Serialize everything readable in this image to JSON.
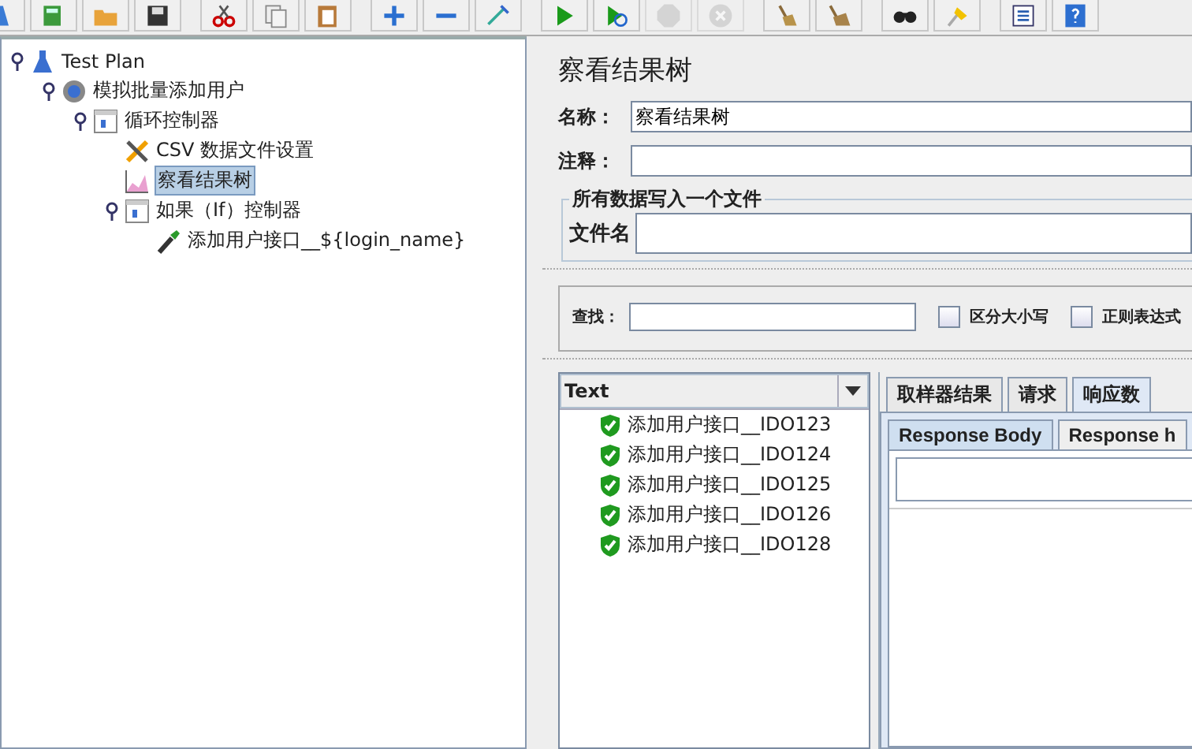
{
  "toolbar": {
    "groups": [
      [
        {
          "kind": "new",
          "disabled": false
        },
        {
          "kind": "templates",
          "disabled": false
        },
        {
          "kind": "open",
          "disabled": false
        },
        {
          "kind": "save",
          "disabled": false
        }
      ],
      [
        {
          "kind": "cut",
          "disabled": false
        },
        {
          "kind": "copy",
          "disabled": false
        },
        {
          "kind": "paste",
          "disabled": false
        }
      ],
      [
        {
          "kind": "expand",
          "disabled": false
        },
        {
          "kind": "collapse",
          "disabled": false
        },
        {
          "kind": "toggle",
          "disabled": false
        }
      ],
      [
        {
          "kind": "start",
          "disabled": false
        },
        {
          "kind": "start-no-pause",
          "disabled": false
        },
        {
          "kind": "stop",
          "disabled": true
        },
        {
          "kind": "shutdown",
          "disabled": true
        }
      ],
      [
        {
          "kind": "clear",
          "disabled": false
        },
        {
          "kind": "clear-all",
          "disabled": false
        }
      ],
      [
        {
          "kind": "search",
          "disabled": false
        },
        {
          "kind": "reset-search",
          "disabled": false
        }
      ],
      [
        {
          "kind": "functions",
          "disabled": false
        },
        {
          "kind": "help",
          "disabled": false
        }
      ]
    ]
  },
  "tree": [
    {
      "label": "Test Plan",
      "kind": "plan",
      "selected": false,
      "children": [
        {
          "label": "模拟批量添加用户",
          "kind": "thread",
          "selected": false,
          "children": [
            {
              "label": "循环控制器",
              "kind": "controller",
              "selected": false,
              "children": [
                {
                  "label": "CSV 数据文件设置",
                  "kind": "config",
                  "selected": false
                },
                {
                  "label": "察看结果树",
                  "kind": "listener",
                  "selected": true
                },
                {
                  "label": "如果（If）控制器",
                  "kind": "controller",
                  "selected": false,
                  "children": [
                    {
                      "label": "添加用户接口__${login_name}",
                      "kind": "sampler",
                      "selected": false
                    }
                  ]
                }
              ]
            }
          ]
        }
      ]
    }
  ],
  "panel": {
    "title": "察看结果树",
    "name_label": "名称：",
    "name_value": "察看结果树",
    "comment_label": "注释：",
    "file_group": "所有数据写入一个文件",
    "file_label": "文件名"
  },
  "search": {
    "label": "查找：",
    "options": [
      {
        "label": "区分大小写",
        "checked": false
      },
      {
        "label": "正则表达式",
        "checked": false
      }
    ]
  },
  "results": {
    "renderer": "Text",
    "items": [
      {
        "label": "添加用户接口__IDO123",
        "passed": true
      },
      {
        "label": "添加用户接口__IDO124",
        "passed": true
      },
      {
        "label": "添加用户接口__IDO125",
        "passed": true
      },
      {
        "label": "添加用户接口__IDO126",
        "passed": true
      },
      {
        "label": "添加用户接口__IDO128",
        "passed": true
      }
    ]
  },
  "tabs": [
    {
      "label": "取样器结果",
      "selected": false
    },
    {
      "label": "请求",
      "selected": false
    },
    {
      "label": "响应数",
      "selected": true
    }
  ],
  "subtabs": [
    {
      "label": "Response Body",
      "selected": true
    },
    {
      "label": "Response h",
      "selected": false
    }
  ]
}
